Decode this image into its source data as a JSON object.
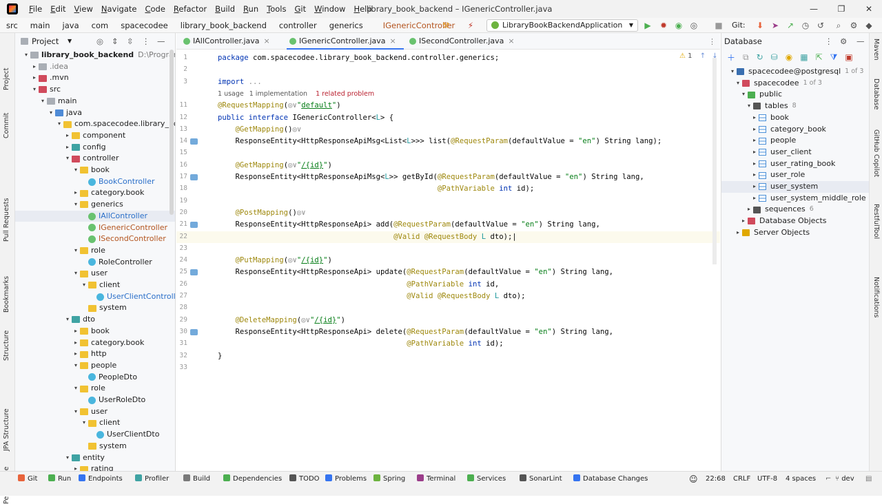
{
  "menu": [
    "File",
    "Edit",
    "View",
    "Navigate",
    "Code",
    "Refactor",
    "Build",
    "Run",
    "Tools",
    "Git",
    "Window",
    "Help"
  ],
  "window_title": "library_book_backend – IGenericController.java",
  "breadcrumbs": [
    "src",
    "main",
    "java",
    "com",
    "spacecodee",
    "library_book_backend",
    "controller",
    "generics",
    "IGenericController"
  ],
  "run_config": "LibraryBookBackendApplication",
  "git_label": "Git:",
  "left_tools": [
    "Project",
    "Commit",
    "Pull Requests",
    "Bookmarks",
    "Structure",
    "JPA Structure",
    "Persistence"
  ],
  "right_tools": [
    "Maven",
    "Database",
    "GitHub Copilot",
    "RestfulTool",
    "Notifications"
  ],
  "project_panel": {
    "title": "Project",
    "items": [
      {
        "label": "library_book_backend",
        "suffix": "D:\\Programaci",
        "depth": 0,
        "arrow": "▾",
        "icon": "fold-gray",
        "style": "bold"
      },
      {
        "label": ".idea",
        "depth": 1,
        "arrow": "▸",
        "icon": "fold-gray",
        "style": "gray"
      },
      {
        "label": ".mvn",
        "depth": 1,
        "arrow": "▸",
        "icon": "fold-red",
        "style": ""
      },
      {
        "label": "src",
        "depth": 1,
        "arrow": "▾",
        "icon": "fold-red",
        "style": ""
      },
      {
        "label": "main",
        "depth": 2,
        "arrow": "▾",
        "icon": "fold-gray",
        "style": ""
      },
      {
        "label": "java",
        "depth": 3,
        "arrow": "▾",
        "icon": "fold-blue",
        "style": ""
      },
      {
        "label": "com.spacecodee.library_book_ba",
        "depth": 4,
        "arrow": "▾",
        "icon": "fold",
        "style": ""
      },
      {
        "label": "component",
        "depth": 5,
        "arrow": "▸",
        "icon": "fold",
        "style": ""
      },
      {
        "label": "config",
        "depth": 5,
        "arrow": "▸",
        "icon": "fold-teal",
        "style": ""
      },
      {
        "label": "controller",
        "depth": 5,
        "arrow": "▾",
        "icon": "fold-red",
        "style": ""
      },
      {
        "label": "book",
        "depth": 6,
        "arrow": "▾",
        "icon": "fold",
        "style": ""
      },
      {
        "label": "BookController",
        "depth": 7,
        "arrow": "",
        "icon": "cls",
        "style": "blue"
      },
      {
        "label": "category.book",
        "depth": 6,
        "arrow": "▸",
        "icon": "fold",
        "style": ""
      },
      {
        "label": "generics",
        "depth": 6,
        "arrow": "▾",
        "icon": "fold",
        "style": ""
      },
      {
        "label": "IAllController",
        "depth": 7,
        "arrow": "",
        "icon": "ifc",
        "style": "blue",
        "selected": true
      },
      {
        "label": "IGenericController",
        "depth": 7,
        "arrow": "",
        "icon": "ifc",
        "style": "orange"
      },
      {
        "label": "ISecondController",
        "depth": 7,
        "arrow": "",
        "icon": "ifc",
        "style": "orange"
      },
      {
        "label": "role",
        "depth": 6,
        "arrow": "▾",
        "icon": "fold",
        "style": ""
      },
      {
        "label": "RoleController",
        "depth": 7,
        "arrow": "",
        "icon": "cls",
        "style": ""
      },
      {
        "label": "user",
        "depth": 6,
        "arrow": "▾",
        "icon": "fold",
        "style": ""
      },
      {
        "label": "client",
        "depth": 7,
        "arrow": "▾",
        "icon": "fold",
        "style": ""
      },
      {
        "label": "UserClientController",
        "depth": 8,
        "arrow": "",
        "icon": "cls",
        "style": "blue"
      },
      {
        "label": "system",
        "depth": 7,
        "arrow": "",
        "icon": "fold",
        "style": ""
      },
      {
        "label": "dto",
        "depth": 5,
        "arrow": "▾",
        "icon": "fold-teal",
        "style": ""
      },
      {
        "label": "book",
        "depth": 6,
        "arrow": "▸",
        "icon": "fold",
        "style": ""
      },
      {
        "label": "category.book",
        "depth": 6,
        "arrow": "▸",
        "icon": "fold",
        "style": ""
      },
      {
        "label": "http",
        "depth": 6,
        "arrow": "▸",
        "icon": "fold",
        "style": ""
      },
      {
        "label": "people",
        "depth": 6,
        "arrow": "▾",
        "icon": "fold",
        "style": ""
      },
      {
        "label": "PeopleDto",
        "depth": 7,
        "arrow": "",
        "icon": "cls",
        "style": ""
      },
      {
        "label": "role",
        "depth": 6,
        "arrow": "▾",
        "icon": "fold",
        "style": ""
      },
      {
        "label": "UserRoleDto",
        "depth": 7,
        "arrow": "",
        "icon": "cls",
        "style": ""
      },
      {
        "label": "user",
        "depth": 6,
        "arrow": "▾",
        "icon": "fold",
        "style": ""
      },
      {
        "label": "client",
        "depth": 7,
        "arrow": "▾",
        "icon": "fold",
        "style": ""
      },
      {
        "label": "UserClientDto",
        "depth": 8,
        "arrow": "",
        "icon": "cls",
        "style": ""
      },
      {
        "label": "system",
        "depth": 7,
        "arrow": "",
        "icon": "fold",
        "style": ""
      },
      {
        "label": "entity",
        "depth": 5,
        "arrow": "▾",
        "icon": "fold-teal",
        "style": ""
      },
      {
        "label": "rating",
        "depth": 6,
        "arrow": "▸",
        "icon": "fold",
        "style": ""
      }
    ]
  },
  "tabs": [
    {
      "label": "IAllController.java",
      "active": false
    },
    {
      "label": "IGenericController.java",
      "active": true
    },
    {
      "label": "ISecondController.java",
      "active": false
    }
  ],
  "inspection": {
    "warnings": "1"
  },
  "code_lines": [
    {
      "n": "1",
      "html": "<span class='kw'>package</span> com.spacecodee.library_book_backend.controller.generics;"
    },
    {
      "n": "2",
      "html": ""
    },
    {
      "n": "3",
      "html": "<span class='kw'>import</span> <span class='gray'>...</span>"
    },
    {
      "n": "",
      "html": "",
      "hint": true
    },
    {
      "n": "11",
      "html": "<span class='ann'>@RequestMapping</span>(<span class='gray'>◎∨</span><span class='str'>\"<u>default</u>\"</span>)"
    },
    {
      "n": "12",
      "html": "<span class='kw'>public interface</span> IGenericController&lt;<span class='gen'>L</span>&gt; {"
    },
    {
      "n": "13",
      "html": "    <span class='ann'>@GetMapping</span>()<span class='gray'>◎∨</span>"
    },
    {
      "n": "14",
      "html": "    ResponseEntity&lt;HttpResponseApiMsg&lt;List&lt;<span class='gen'>L</span>&gt;&gt;&gt; list(<span class='ann'>@RequestParam</span>(defaultValue = <span class='str'>\"en\"</span>) String lang);",
      "g": true
    },
    {
      "n": "15",
      "html": ""
    },
    {
      "n": "16",
      "html": "    <span class='ann'>@GetMapping</span>(<span class='gray'>◎∨</span><span class='str'>\"<u>/{id}</u>\"</span>)"
    },
    {
      "n": "17",
      "html": "    ResponseEntity&lt;HttpResponseApiMsg&lt;<span class='gen'>L</span>&gt;&gt; getById(<span class='ann'>@RequestParam</span>(defaultValue = <span class='str'>\"en\"</span>) String lang,",
      "g": true
    },
    {
      "n": "18",
      "html": "                                                  <span class='ann'>@PathVariable</span> <span class='kw'>int</span> id);"
    },
    {
      "n": "19",
      "html": ""
    },
    {
      "n": "20",
      "html": "    <span class='ann'>@PostMapping</span>()<span class='gray'>◎∨</span>"
    },
    {
      "n": "21",
      "html": "    ResponseEntity&lt;HttpResponseApi&gt; add(<span class='ann'>@RequestParam</span>(defaultValue = <span class='str'>\"en\"</span>) String lang,",
      "g": true
    },
    {
      "n": "22",
      "html": "                                        <span class='ann'>@Valid @RequestBody</span> <span class='gen'>L</span> dto);|",
      "cur": true
    },
    {
      "n": "23",
      "html": ""
    },
    {
      "n": "24",
      "html": "    <span class='ann'>@PutMapping</span>(<span class='gray'>◎∨</span><span class='str'>\"<u>/{id}</u>\"</span>)"
    },
    {
      "n": "25",
      "html": "    ResponseEntity&lt;HttpResponseApi&gt; update(<span class='ann'>@RequestParam</span>(defaultValue = <span class='str'>\"en\"</span>) String lang,",
      "g": true
    },
    {
      "n": "26",
      "html": "                                           <span class='ann'>@PathVariable</span> <span class='kw'>int</span> id,"
    },
    {
      "n": "27",
      "html": "                                           <span class='ann'>@Valid @RequestBody</span> <span class='gen'>L</span> dto);"
    },
    {
      "n": "28",
      "html": ""
    },
    {
      "n": "29",
      "html": "    <span class='ann'>@DeleteMapping</span>(<span class='gray'>◎∨</span><span class='str'>\"<u>/{id}</u>\"</span>)"
    },
    {
      "n": "30",
      "html": "    ResponseEntity&lt;HttpResponseApi&gt; delete(<span class='ann'>@RequestParam</span>(defaultValue = <span class='str'>\"en\"</span>) String lang,",
      "g": true
    },
    {
      "n": "31",
      "html": "                                           <span class='ann'>@PathVariable</span> <span class='kw'>int</span> id);"
    },
    {
      "n": "32",
      "html": "}"
    },
    {
      "n": "33",
      "html": ""
    }
  ],
  "usage_hint": {
    "usages": "1 usage",
    "impl": "1 implementation",
    "problem": "1 related problem"
  },
  "database_panel": {
    "title": "Database",
    "items": [
      {
        "label": "spacecodee@postgresql",
        "count": "1 of 3",
        "depth": 0,
        "arrow": "▾",
        "type": "server"
      },
      {
        "label": "spacecodee",
        "count": "1 of 3",
        "depth": 1,
        "arrow": "▾",
        "type": "db"
      },
      {
        "label": "public",
        "count": "",
        "depth": 2,
        "arrow": "▾",
        "type": "schema"
      },
      {
        "label": "tables",
        "count": "8",
        "depth": 3,
        "arrow": "▾",
        "type": "folder"
      },
      {
        "label": "book",
        "count": "",
        "depth": 4,
        "arrow": "▸",
        "type": "table"
      },
      {
        "label": "category_book",
        "count": "",
        "depth": 4,
        "arrow": "▸",
        "type": "table"
      },
      {
        "label": "people",
        "count": "",
        "depth": 4,
        "arrow": "▸",
        "type": "table"
      },
      {
        "label": "user_client",
        "count": "",
        "depth": 4,
        "arrow": "▸",
        "type": "table"
      },
      {
        "label": "user_rating_book",
        "count": "",
        "depth": 4,
        "arrow": "▸",
        "type": "table"
      },
      {
        "label": "user_role",
        "count": "",
        "depth": 4,
        "arrow": "▸",
        "type": "table"
      },
      {
        "label": "user_system",
        "count": "",
        "depth": 4,
        "arrow": "▸",
        "type": "table",
        "selected": true
      },
      {
        "label": "user_system_middle_role",
        "count": "",
        "depth": 4,
        "arrow": "▸",
        "type": "table"
      },
      {
        "label": "sequences",
        "count": "6",
        "depth": 3,
        "arrow": "▸",
        "type": "folder"
      },
      {
        "label": "Database Objects",
        "count": "",
        "depth": 2,
        "arrow": "▸",
        "type": "dbobj"
      },
      {
        "label": "Server Objects",
        "count": "",
        "depth": 1,
        "arrow": "▸",
        "type": "srvobj"
      }
    ]
  },
  "status_tools": [
    {
      "label": "Git",
      "color": "#e8643c"
    },
    {
      "label": "Run",
      "color": "#4caf50"
    },
    {
      "label": "Endpoints",
      "color": "#3574f0"
    },
    {
      "label": "Profiler",
      "color": "#3fa3a3"
    },
    {
      "label": "Build",
      "color": "#7a7a7a"
    },
    {
      "label": "Dependencies",
      "color": "#4caf50"
    },
    {
      "label": "TODO",
      "color": "#555"
    },
    {
      "label": "Problems",
      "color": "#3574f0"
    },
    {
      "label": "Spring",
      "color": "#6db33f"
    },
    {
      "label": "Terminal",
      "color": "#9b3d8a"
    },
    {
      "label": "Services",
      "color": "#4caf50"
    },
    {
      "label": "SonarLint",
      "color": "#555"
    },
    {
      "label": "Database Changes",
      "color": "#3574f0"
    }
  ],
  "status_right": {
    "position": "22:68",
    "line_sep": "CRLF",
    "encoding": "UTF-8",
    "indent": "4 spaces",
    "branch": "dev"
  }
}
